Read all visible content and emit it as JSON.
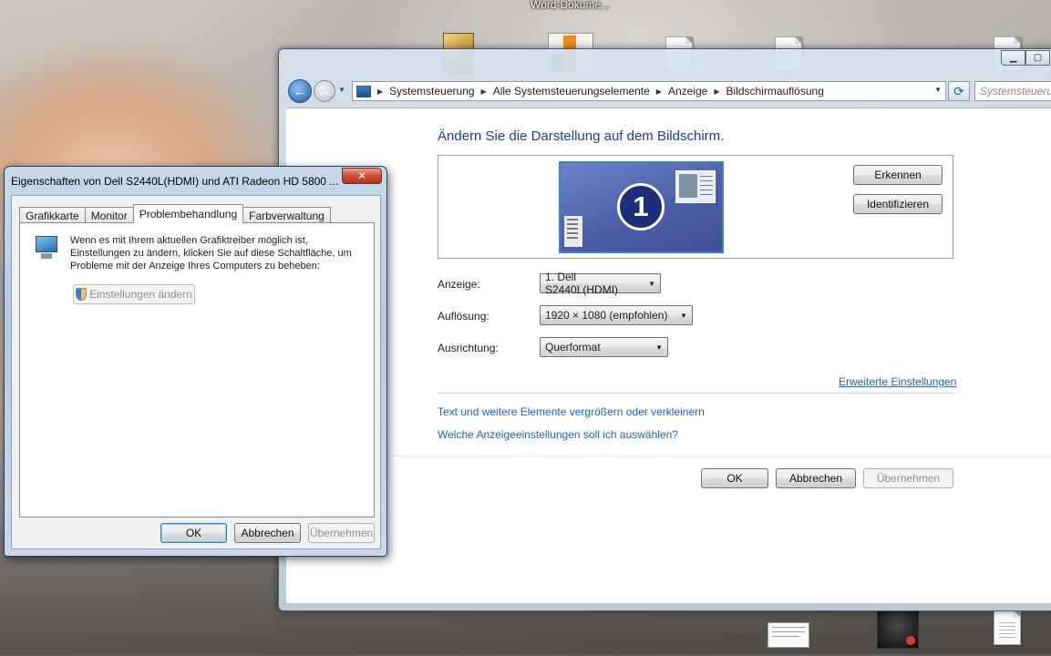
{
  "desktop": {
    "caption": "Word-Dokume..."
  },
  "main_window": {
    "breadcrumbs": [
      "Systemsteuerung",
      "Alle Systemsteuerungselemente",
      "Anzeige",
      "Bildschirmauflösung"
    ],
    "search_placeholder": "Systemsteuerun",
    "page_title": "Ändern Sie die Darstellung auf dem Bildschirm.",
    "monitor_number": "1",
    "detect_button": "Erkennen",
    "identify_button": "Identifizieren",
    "display_label": "Anzeige:",
    "display_value": "1. Dell S2440L(HDMI)",
    "resolution_label": "Auflösung:",
    "resolution_value": "1920 × 1080 (empfohlen)",
    "orientation_label": "Ausrichtung:",
    "orientation_value": "Querformat",
    "advanced_link": "Erweiterte Einstellungen",
    "link_text_size": "Text und weitere Elemente vergrößern oder verkleinern",
    "link_which_settings": "Welche Anzeigeeinstellungen soll ich auswählen?",
    "ok_button": "OK",
    "cancel_button": "Abbrechen",
    "apply_button": "Übernehmen"
  },
  "dialog": {
    "title": "Eigenschaften von Dell S2440L(HDMI) und ATI Radeon HD 5800 ...",
    "close_glyph": "✕",
    "tabs": [
      "Grafikkarte",
      "Monitor",
      "Problembehandlung",
      "Farbverwaltung"
    ],
    "active_tab": "Problembehandlung",
    "info_text": "Wenn es mit Ihrem aktuellen Grafiktreiber möglich ist, Einstellungen zu ändern, klicken Sie auf diese Schaltfläche, um Probleme mit der Anzeige Ihres Computers zu beheben:",
    "change_settings_button": "Einstellungen ändern",
    "ok_button": "OK",
    "cancel_button": "Abbrechen",
    "apply_button": "Übernehmen"
  }
}
